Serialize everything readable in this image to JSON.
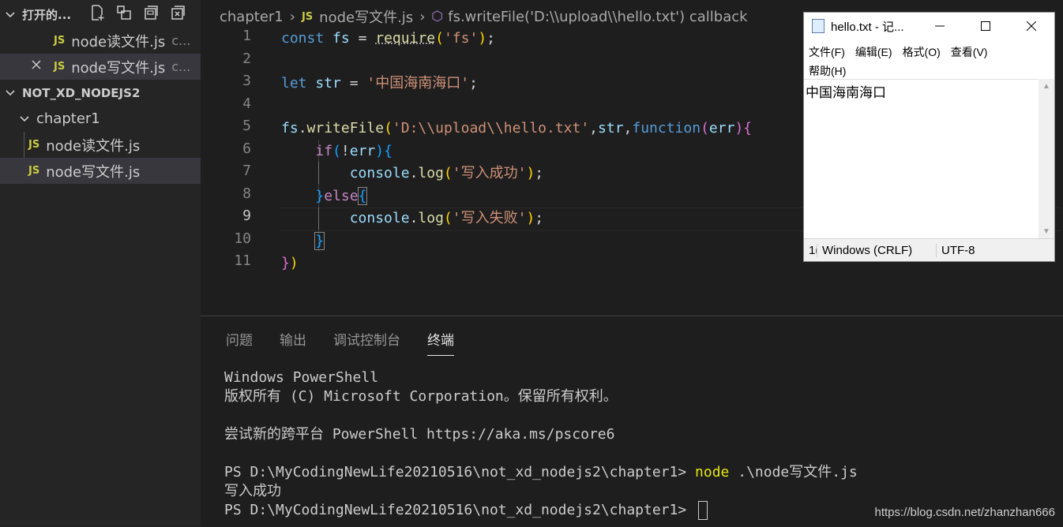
{
  "sidebar": {
    "open_editors_label": "打开的...",
    "open_files": [
      {
        "name": "node读文件.js",
        "desc": "c..."
      },
      {
        "name": "node写文件.js",
        "desc": "c..."
      }
    ],
    "folder_label": "NOT_XD_NODEJS2",
    "subfolder_label": "chapter1",
    "tree_files": [
      "node读文件.js",
      "node写文件.js"
    ],
    "js_badge": "JS"
  },
  "breadcrumb": {
    "folder": "chapter1",
    "file": "node写文件.js",
    "symbol": "fs.writeFile('D:\\\\upload\\\\hello.txt') callback"
  },
  "code": {
    "line_numbers": [
      "1",
      "2",
      "3",
      "4",
      "5",
      "6",
      "7",
      "8",
      "9",
      "10",
      "11"
    ],
    "active_line": "9"
  },
  "panel": {
    "tabs": [
      "问题",
      "输出",
      "调试控制台",
      "终端"
    ],
    "active_tab": "终端",
    "terminal": {
      "l1": "Windows PowerShell",
      "l2": "版权所有 (C) Microsoft Corporation。保留所有权利。",
      "l3": "尝试新的跨平台 PowerShell https://aka.ms/pscore6",
      "prompt1": "PS D:\\MyCodingNewLife20210516\\not_xd_nodejs2\\chapter1> ",
      "cmd": "node",
      "cmd_arg": " .\\node写文件.js",
      "output": "写入成功",
      "prompt2": "PS D:\\MyCodingNewLife20210516\\not_xd_nodejs2\\chapter1> "
    }
  },
  "notepad": {
    "title": "hello.txt - 记...",
    "menu": [
      "文件(F)",
      "编辑(E)",
      "格式(O)",
      "查看(V)",
      "帮助(H)"
    ],
    "content": "中国海南海口",
    "status_pos": "1(",
    "status_eol": "Windows (CRLF)",
    "status_enc": "UTF-8"
  },
  "watermark": "https://blog.csdn.net/zhanzhan666"
}
